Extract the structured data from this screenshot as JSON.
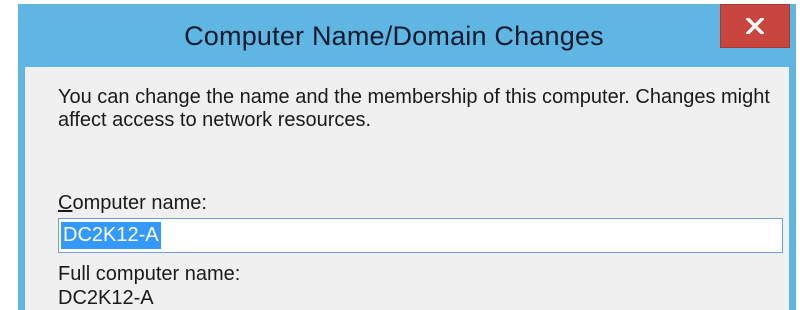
{
  "dialog": {
    "title": "Computer Name/Domain Changes",
    "description": "You can change the name and the membership of this computer. Changes might affect access to network resources.",
    "computer_name_label_accel": "C",
    "computer_name_label_rest": "omputer name:",
    "computer_name_value": "DC2K12-A",
    "full_computer_name_label": "Full computer name:",
    "full_computer_name_value": "DC2K12-A"
  },
  "icons": {
    "close": "close-icon"
  },
  "colors": {
    "titlebar": "#5fb6e2",
    "close_button": "#c8463d",
    "client_background": "#f0f0f0",
    "selection": "#3399ff"
  }
}
